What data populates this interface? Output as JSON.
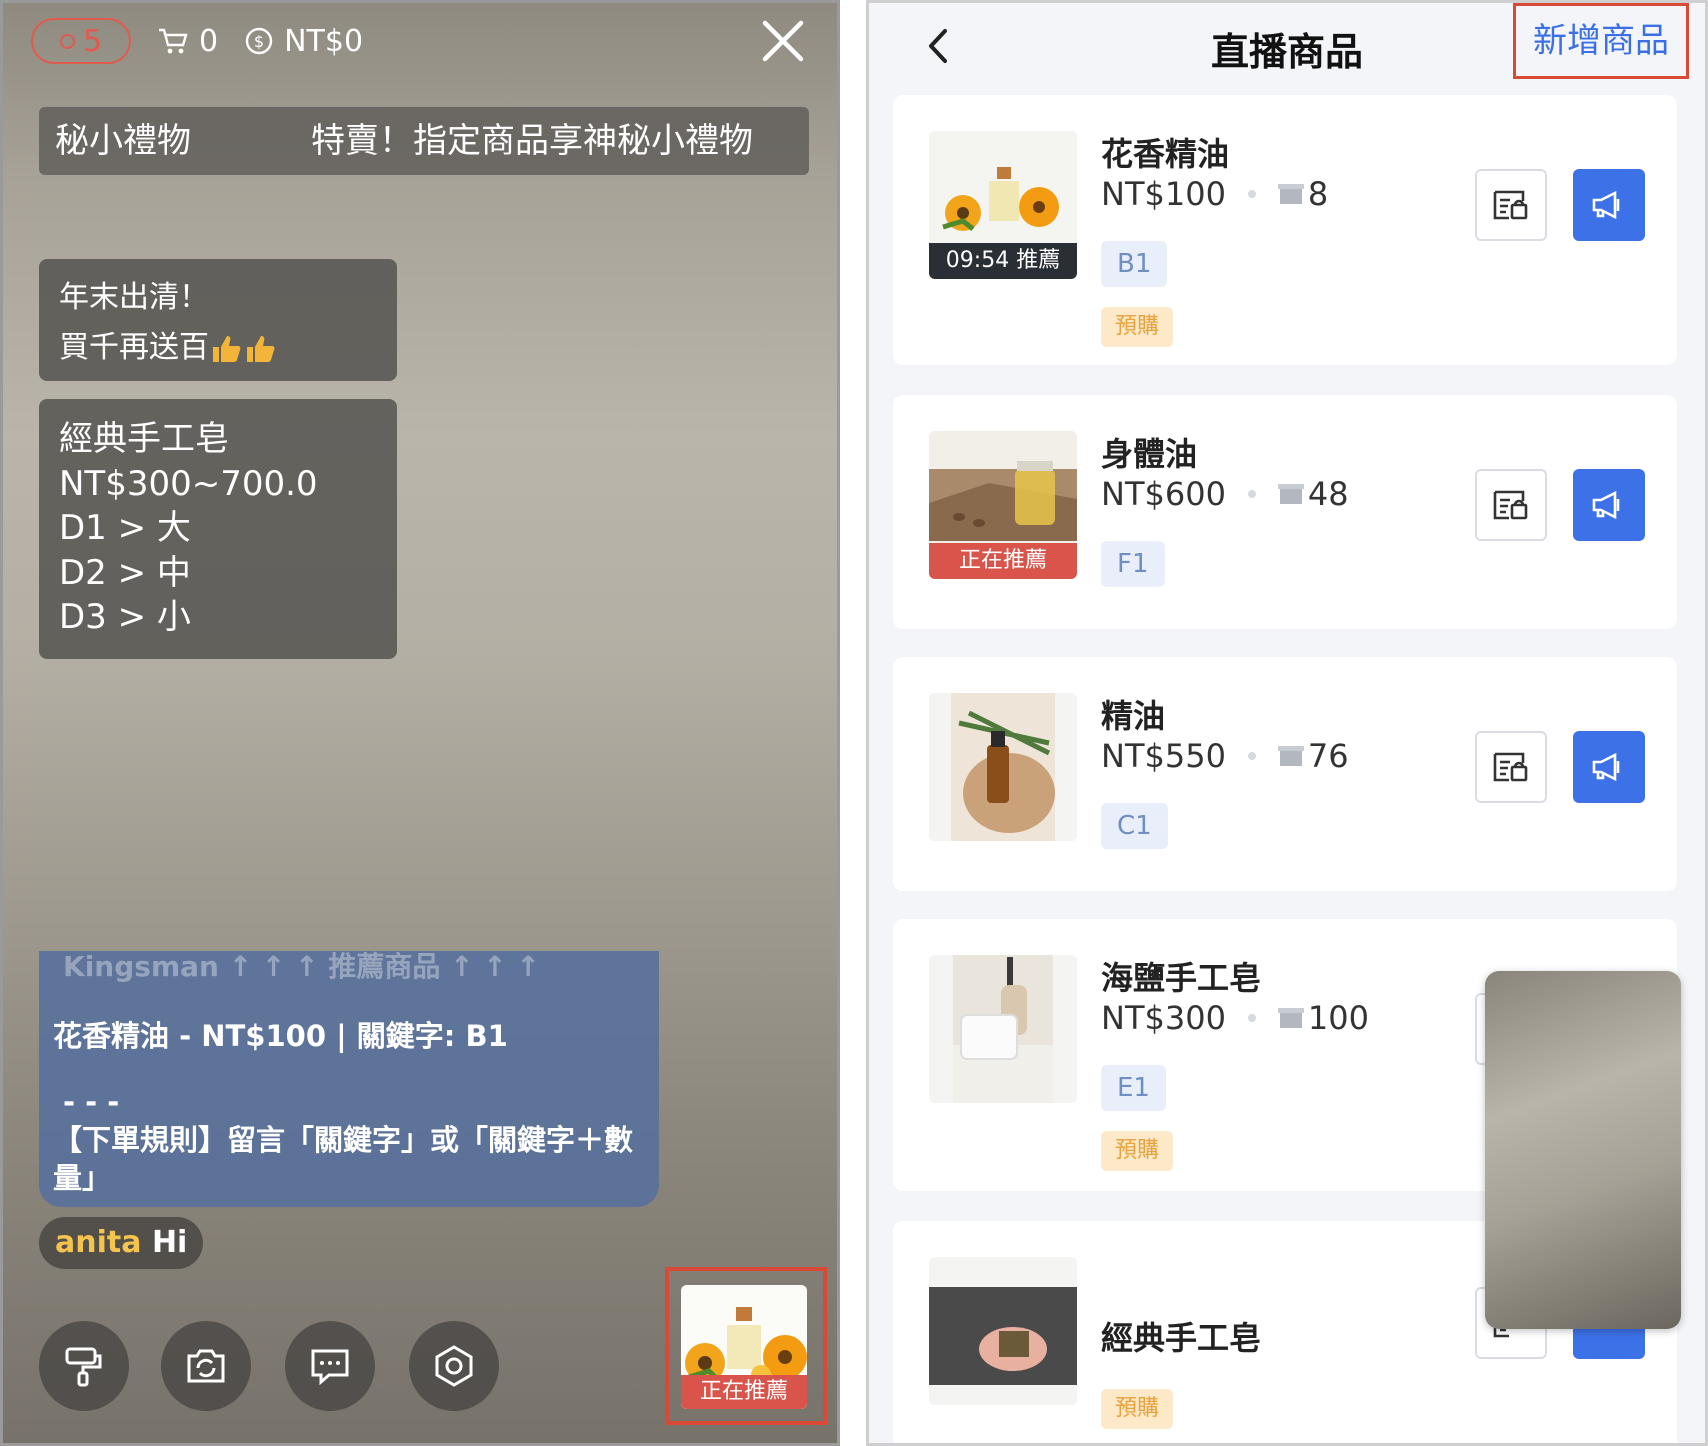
{
  "live": {
    "viewer_count": "5",
    "cart_count": "0",
    "sales_total": "NT$0",
    "marquee_left": "秘小禮物",
    "marquee_right": "特賣！指定商品享神秘小禮物",
    "message1_line1": "年末出清！",
    "message1_line2": "買千再送百",
    "message2_lines": [
      "經典手工皂",
      "NT$300~700.0",
      "D1 > 大",
      "D2 > 中",
      "D3 > 小"
    ],
    "pinned_header": "Kingsman  ↑ ↑ ↑ 推薦商品 ↑ ↑ ↑",
    "pinned_line1": "花香精油 - NT$100 | 關鍵字: B1",
    "pinned_line2": "- - -",
    "pinned_line3": "【下單規則】留言「關鍵字」或「關鍵字＋數量」",
    "comment_user": "anita",
    "comment_text": "Hi",
    "recommend_label": "正在推薦"
  },
  "list": {
    "title": "直播商品",
    "add_button": "新增商品",
    "products": [
      {
        "name": "花香精油",
        "price": "NT$100",
        "stock": "8",
        "keyword": "B1",
        "preorder": "預購",
        "status": "09:54 推薦"
      },
      {
        "name": "身體油",
        "price": "NT$600",
        "stock": "48",
        "keyword": "F1",
        "status": "正在推薦"
      },
      {
        "name": "精油",
        "price": "NT$550",
        "stock": "76",
        "keyword": "C1"
      },
      {
        "name": "海鹽手工皂",
        "price": "NT$300",
        "stock": "100",
        "keyword": "E1",
        "preorder": "預購"
      },
      {
        "name": "經典手工皂",
        "preorder": "預購"
      }
    ]
  },
  "icons": [
    "viewer-dot-icon",
    "cart-icon",
    "coin-icon",
    "close-icon",
    "paint-roller-icon",
    "camera-switch-icon",
    "chat-icon",
    "settings-icon",
    "back-icon",
    "stock-box-icon",
    "edit-product-icon",
    "megaphone-icon"
  ],
  "colors": {
    "accent_blue": "#3c71e8",
    "highlight_red": "#d84a36",
    "preorder_bg": "#fde9c8"
  }
}
